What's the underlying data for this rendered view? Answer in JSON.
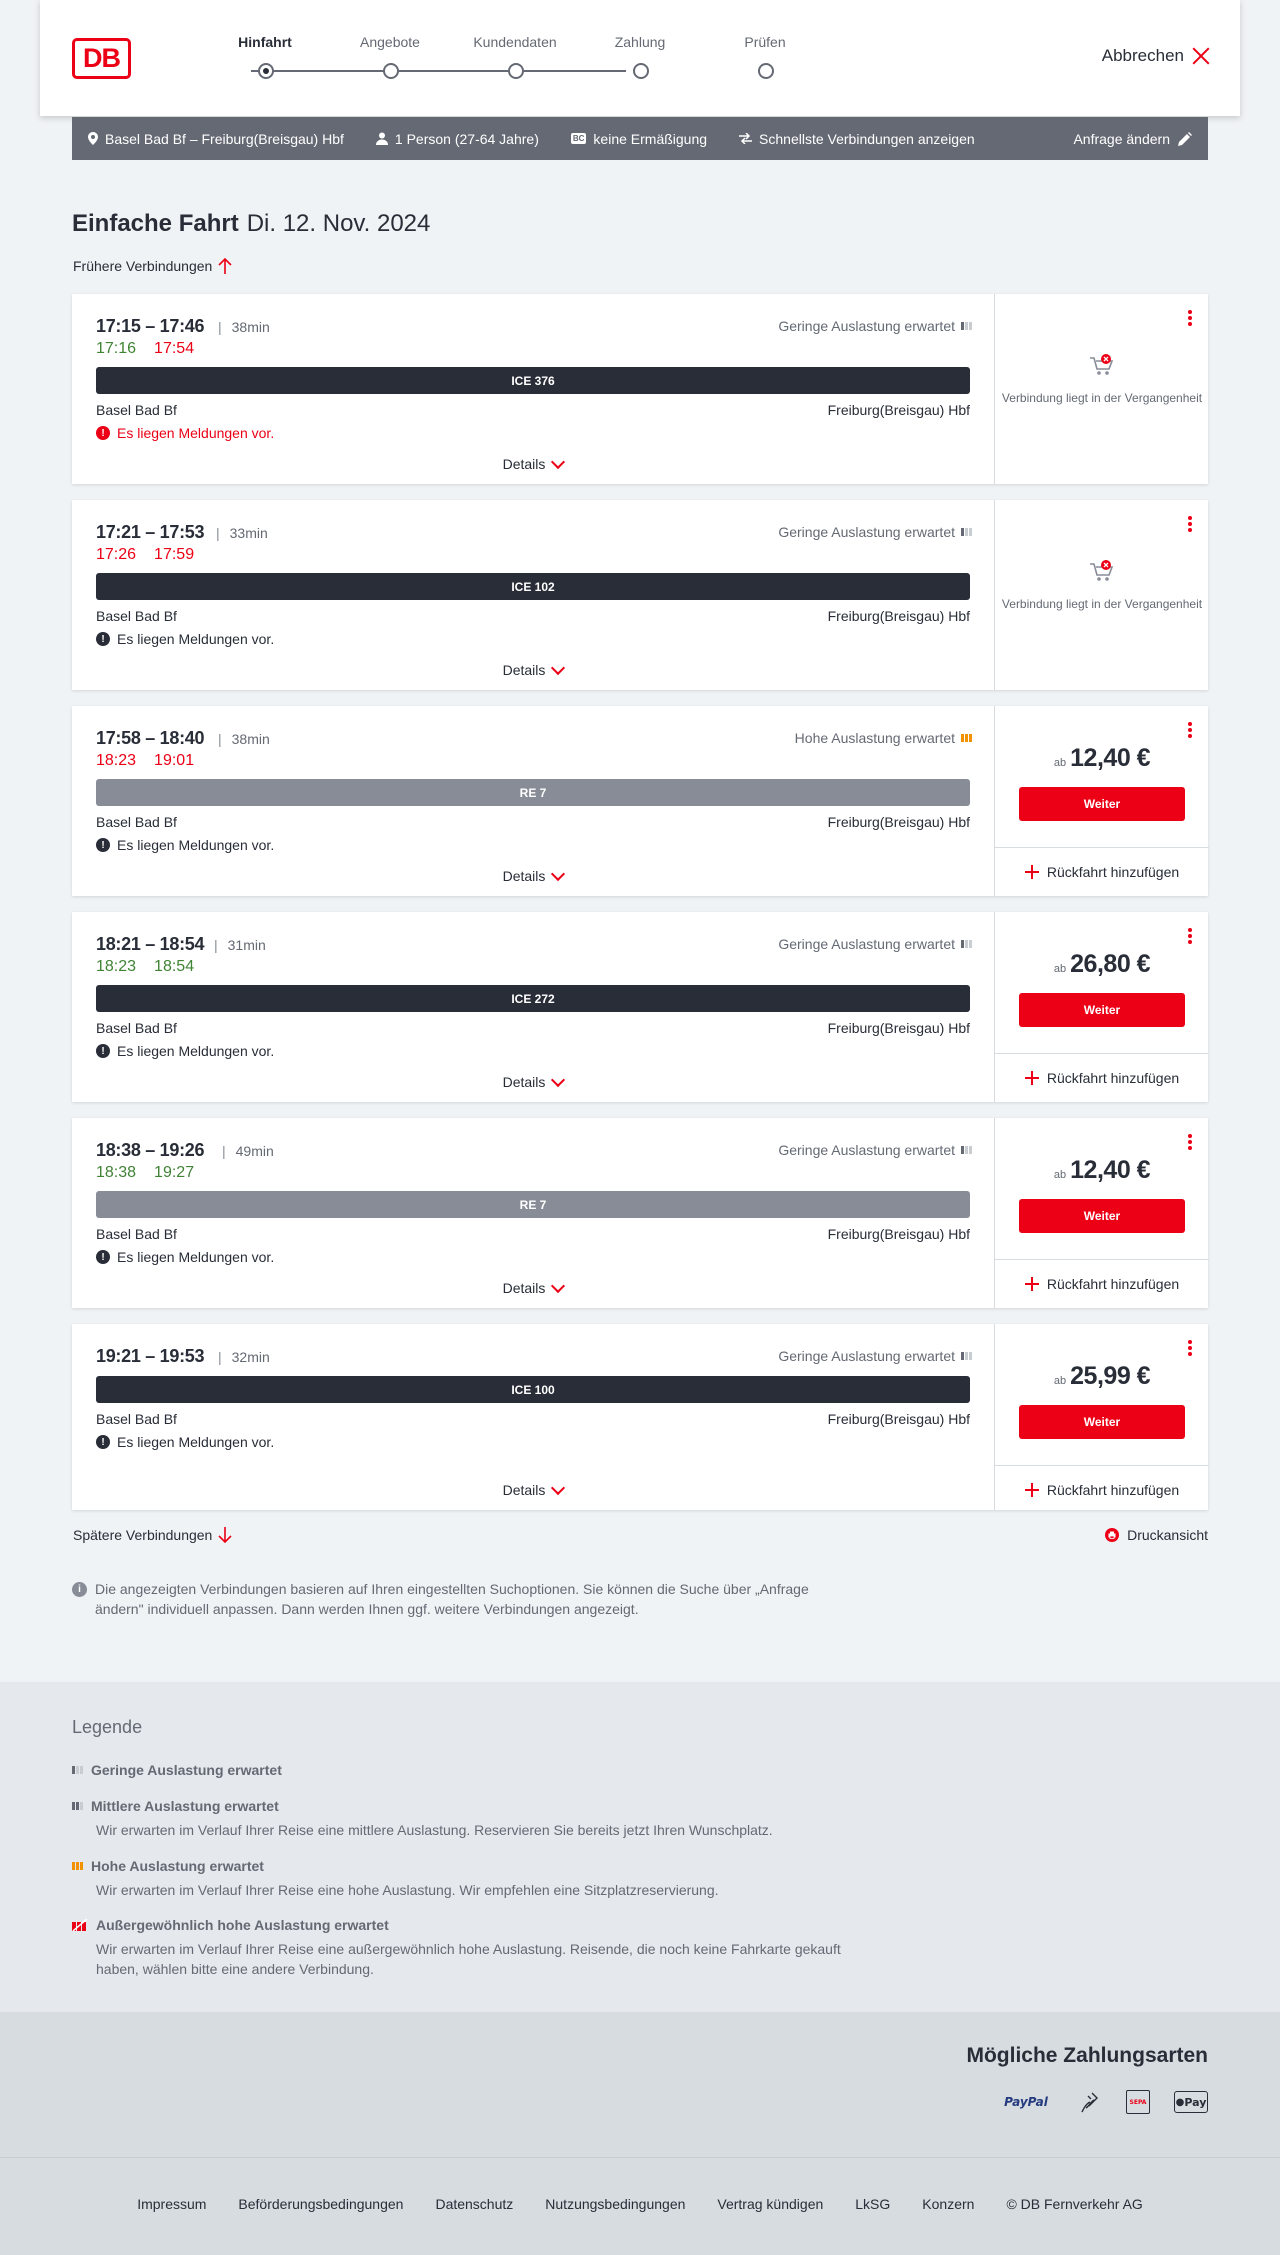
{
  "header": {
    "logo_text": "DB",
    "steps": [
      {
        "label": "Hinfahrt",
        "active": true
      },
      {
        "label": "Angebote"
      },
      {
        "label": "Kundendaten"
      },
      {
        "label": "Zahlung"
      },
      {
        "label": "Prüfen"
      }
    ],
    "cancel_label": "Abbrechen"
  },
  "search": {
    "route": "Basel Bad Bf – Freiburg(Breisgau) Hbf",
    "passengers": "1 Person (27-64 Jahre)",
    "discount_badge": "BC",
    "discount": "keine Ermäßigung",
    "fastest": "Schnellste Verbindungen anzeigen",
    "change": "Anfrage ändern"
  },
  "page": {
    "title": "Einfache Fahrt",
    "date": "Di. 12. Nov. 2024",
    "earlier": "Frühere Verbindungen",
    "later": "Spätere Verbindungen",
    "print": "Druckansicht",
    "info": "Die angezeigten Verbindungen basieren auf Ihren eingestellten Suchoptionen. Sie können die Suche über „Anfrage ändern\" individuell anpassen. Dann werden Ihnen ggf. weitere Verbindungen angezeigt."
  },
  "connections": [
    {
      "times": "17:15 – 17:46",
      "duration": "38min",
      "rt_dep": "17:16",
      "rt_dep_status": "on",
      "rt_arr": "17:54",
      "rt_arr_status": "late",
      "load": "Geringe Auslastung erwartet",
      "load_level": "low",
      "train": "ICE 376",
      "train_type": "ice",
      "from": "Basel Bad Bf",
      "to": "Freiburg(Breisgau) Hbf",
      "message": "Es liegen Meldungen vor.",
      "message_red": true,
      "details": "Details",
      "past": "Verbindung liegt in der Vergangenheit"
    },
    {
      "times": "17:21 – 17:53",
      "duration": "33min",
      "rt_dep": "17:26",
      "rt_dep_status": "late",
      "rt_arr": "17:59",
      "rt_arr_status": "late",
      "load": "Geringe Auslastung erwartet",
      "load_level": "low",
      "train": "ICE 102",
      "train_type": "ice",
      "from": "Basel Bad Bf",
      "to": "Freiburg(Breisgau) Hbf",
      "message": "Es liegen Meldungen vor.",
      "details": "Details",
      "past": "Verbindung liegt in der Vergangenheit"
    },
    {
      "times": "17:58 – 18:40",
      "duration": "38min",
      "rt_dep": "18:23",
      "rt_dep_status": "late",
      "rt_arr": "19:01",
      "rt_arr_status": "late",
      "load": "Hohe Auslastung erwartet",
      "load_level": "high",
      "train": "RE 7",
      "train_type": "re",
      "from": "Basel Bad Bf",
      "to": "Freiburg(Breisgau) Hbf",
      "message": "Es liegen Meldungen vor.",
      "details": "Details",
      "price_prefix": "ab",
      "price": "12,40 €",
      "button": "Weiter",
      "return": "Rückfahrt hinzufügen"
    },
    {
      "times": "18:21 – 18:54",
      "duration": "31min",
      "rt_dep": "18:23",
      "rt_dep_status": "on",
      "rt_arr": "18:54",
      "rt_arr_status": "on",
      "load": "Geringe Auslastung erwartet",
      "load_level": "low",
      "train": "ICE 272",
      "train_type": "ice",
      "from": "Basel Bad Bf",
      "to": "Freiburg(Breisgau) Hbf",
      "message": "Es liegen Meldungen vor.",
      "details": "Details",
      "price_prefix": "ab",
      "price": "26,80 €",
      "button": "Weiter",
      "return": "Rückfahrt hinzufügen"
    },
    {
      "times": "18:38 – 19:26",
      "duration": "49min",
      "rt_dep": "18:38",
      "rt_dep_status": "on",
      "rt_arr": "19:27",
      "rt_arr_status": "on",
      "load": "Geringe Auslastung erwartet",
      "load_level": "low",
      "train": "RE 7",
      "train_type": "re",
      "from": "Basel Bad Bf",
      "to": "Freiburg(Breisgau) Hbf",
      "message": "Es liegen Meldungen vor.",
      "details": "Details",
      "price_prefix": "ab",
      "price": "12,40 €",
      "button": "Weiter",
      "return": "Rückfahrt hinzufügen"
    },
    {
      "times": "19:21 – 19:53",
      "duration": "32min",
      "rt_dep": "",
      "rt_dep_status": "",
      "rt_arr": "",
      "rt_arr_status": "",
      "load": "Geringe Auslastung erwartet",
      "load_level": "low",
      "train": "ICE 100",
      "train_type": "ice",
      "from": "Basel Bad Bf",
      "to": "Freiburg(Breisgau) Hbf",
      "message": "Es liegen Meldungen vor.",
      "details": "Details",
      "price_prefix": "ab",
      "price": "25,99 €",
      "button": "Weiter",
      "return": "Rückfahrt hinzufügen"
    }
  ],
  "legend": {
    "title": "Legende",
    "items": [
      {
        "title": "Geringe Auslastung erwartet",
        "desc": "",
        "icon": "load-low-icon"
      },
      {
        "title": "Mittlere Auslastung erwartet",
        "desc": "Wir erwarten im Verlauf Ihrer Reise eine mittlere Auslastung. Reservieren Sie bereits jetzt Ihren Wunschplatz.",
        "icon": "load-medium-icon"
      },
      {
        "title": "Hohe Auslastung erwartet",
        "desc": "Wir erwarten im Verlauf Ihrer Reise eine hohe Auslastung. Wir empfehlen eine Sitzplatzreservierung.",
        "icon": "load-high-icon"
      },
      {
        "title": "Außergewöhnlich hohe Auslastung erwartet",
        "desc": "Wir erwarten im Verlauf Ihrer Reise eine außergewöhnlich hohe Auslastung. Reisende, die noch keine Fahrkarte gekauft haben, wählen bitte eine andere Verbindung.",
        "icon": "load-extreme-icon"
      }
    ]
  },
  "payment": {
    "title": "Mögliche Zahlungsarten",
    "paypal": "PayPal",
    "sepa": "SEPA",
    "applepay": "Pay"
  },
  "footer": {
    "links": [
      "Impressum",
      "Beförderungsbedingungen",
      "Datenschutz",
      "Nutzungsbedingungen",
      "Vertrag kündigen",
      "LkSG",
      "Konzern",
      "© DB Fernverkehr AG"
    ]
  },
  "colors": {
    "brand_red": "#ec0016",
    "on_time_green": "#408335",
    "dark": "#282d37",
    "grey": "#646973",
    "high_load_orange": "#f39200"
  }
}
